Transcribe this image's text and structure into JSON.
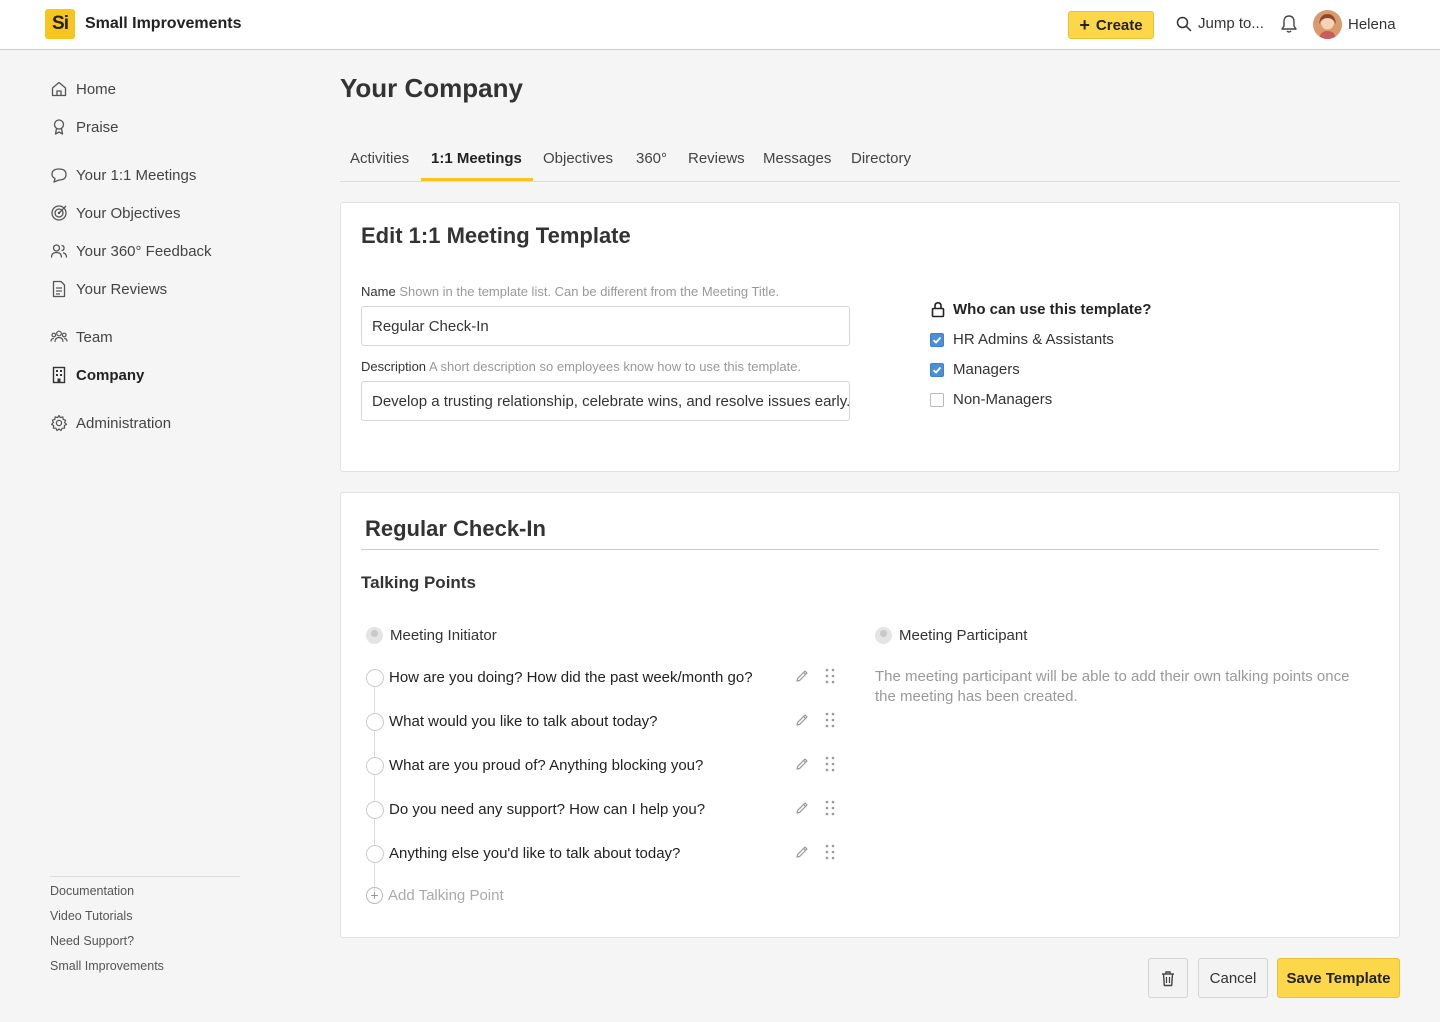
{
  "app": {
    "logo": "Si",
    "title": "Small Improvements"
  },
  "header": {
    "create_label": "Create",
    "jump_label": "Jump to...",
    "user_name": "Helena"
  },
  "sidebar": {
    "items": [
      {
        "label": "Home",
        "icon": "home-icon"
      },
      {
        "label": "Praise",
        "icon": "ribbon-icon"
      },
      {
        "label": "Your 1:1 Meetings",
        "icon": "chat-icon"
      },
      {
        "label": "Your Objectives",
        "icon": "target-icon"
      },
      {
        "label": "Your 360° Feedback",
        "icon": "people-icon"
      },
      {
        "label": "Your Reviews",
        "icon": "document-icon"
      },
      {
        "label": "Team",
        "icon": "team-icon"
      },
      {
        "label": "Company",
        "icon": "building-icon",
        "active": true
      },
      {
        "label": "Administration",
        "icon": "gear-icon"
      }
    ],
    "footer_links": [
      "Documentation",
      "Video Tutorials",
      "Need Support?",
      "Small Improvements"
    ]
  },
  "page": {
    "title": "Your Company"
  },
  "tabs": [
    {
      "label": "Activities"
    },
    {
      "label": "1:1 Meetings",
      "active": true
    },
    {
      "label": "Objectives"
    },
    {
      "label": "360°"
    },
    {
      "label": "Reviews"
    },
    {
      "label": "Messages"
    },
    {
      "label": "Directory"
    }
  ],
  "template_form": {
    "title": "Edit 1:1 Meeting Template",
    "name_label": "Name",
    "name_hint": "Shown in the template list. Can be different from the Meeting Title.",
    "name_value": "Regular Check-In",
    "description_label": "Description",
    "description_hint": "A short description so employees know how to use this template.",
    "description_value": "Develop a trusting relationship, celebrate wins, and resolve issues early.",
    "permissions_title": "Who can use this template?",
    "permissions": [
      {
        "label": "HR Admins & Assistants",
        "checked": true
      },
      {
        "label": "Managers",
        "checked": true
      },
      {
        "label": "Non-Managers",
        "checked": false
      }
    ]
  },
  "preview": {
    "title": "Regular Check-In",
    "talking_points_title": "Talking Points",
    "initiator_label": "Meeting Initiator",
    "participant_label": "Meeting Participant",
    "talking_points": [
      "How are you doing? How did the past week/month go?",
      "What would you like to talk about today?",
      "What are you proud of? Anything blocking you?",
      "Do you need any support? How can I help you?",
      "Anything else you'd like to talk about today?"
    ],
    "add_talking_point_label": "Add Talking Point",
    "participant_note": "The meeting participant will be able to add their own talking points once the meeting has been created."
  },
  "actions": {
    "cancel_label": "Cancel",
    "save_label": "Save Template"
  },
  "colors": {
    "brand_yellow": "#fcd74a",
    "checkbox_blue": "#4a90d9"
  }
}
